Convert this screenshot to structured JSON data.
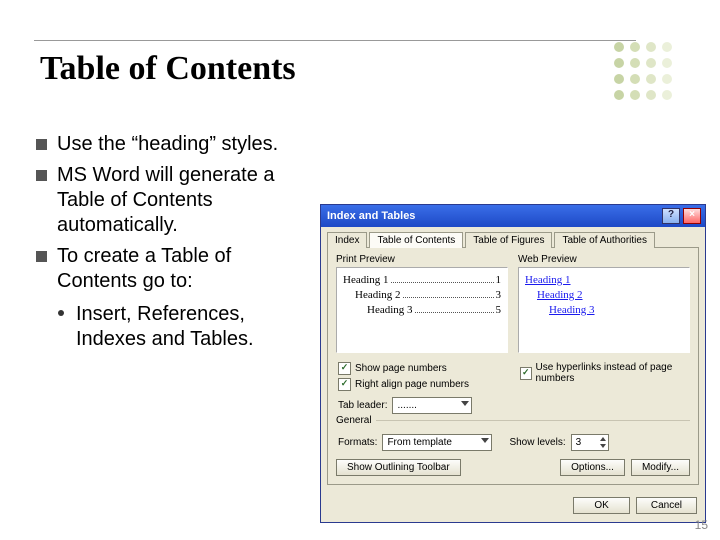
{
  "slide": {
    "title": "Table of Contents",
    "bullets": [
      "Use the “heading” styles.",
      "MS Word will generate a Table of Contents automatically.",
      "To create a Table of Contents go to:"
    ],
    "sub_bullet": "Insert, References, Indexes and Tables."
  },
  "dialog": {
    "title": "Index and Tables",
    "help_glyph": "?",
    "close_glyph": "×",
    "tabs": [
      "Index",
      "Table of Contents",
      "Table of Figures",
      "Table of Authorities"
    ],
    "print_preview_label": "Print Preview",
    "web_preview_label": "Web Preview",
    "print_preview": [
      {
        "label": "Heading 1",
        "page": "1",
        "indent": 0
      },
      {
        "label": "Heading 2",
        "page": "3",
        "indent": 1
      },
      {
        "label": "Heading 3",
        "page": "5",
        "indent": 2
      }
    ],
    "web_preview": [
      "Heading 1",
      "Heading 2",
      "Heading 3"
    ],
    "show_page_numbers_label": "Show page numbers",
    "right_align_label": "Right align page numbers",
    "hyperlinks_label": "Use hyperlinks instead of page numbers",
    "check_glyph": "✓",
    "tab_leader_label": "Tab leader:",
    "tab_leader_value": ".......",
    "general_label": "General",
    "formats_label": "Formats:",
    "formats_value": "From template",
    "show_levels_label": "Show levels:",
    "show_levels_value": "3",
    "outlining_btn": "Show Outlining Toolbar",
    "options_btn": "Options...",
    "modify_btn": "Modify...",
    "ok_btn": "OK",
    "cancel_btn": "Cancel"
  },
  "footer_page": "15"
}
